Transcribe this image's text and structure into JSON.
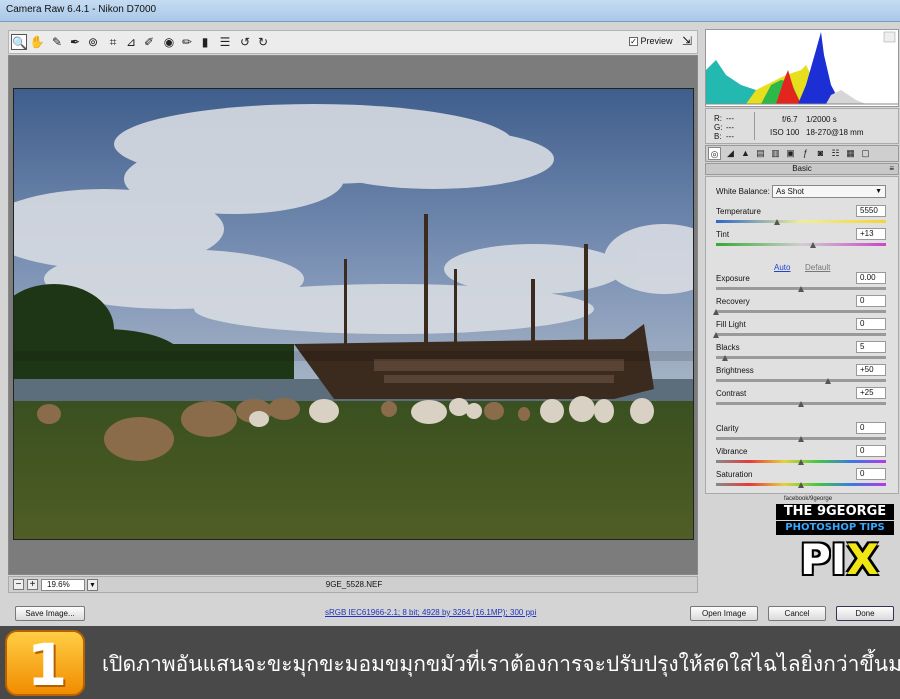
{
  "window": {
    "title": "Camera Raw 6.4.1  -  Nikon D7000"
  },
  "toolbar": {
    "tools": [
      "zoom-tool",
      "hand-tool",
      "white-balance-tool",
      "color-sampler-tool",
      "target-adjustment-tool",
      "crop-tool",
      "straighten-tool",
      "spot-removal-tool",
      "red-eye-tool",
      "adjustment-brush-tool",
      "graduated-filter-tool",
      "preferences",
      "rotate-ccw",
      "rotate-cw"
    ],
    "preview_label": "Preview",
    "preview_checked": true
  },
  "status": {
    "zoom": "19.6%",
    "filename": "9GE_5528.NEF"
  },
  "info": {
    "r_label": "R:",
    "r_val": "---",
    "g_label": "G:",
    "g_val": "---",
    "b_label": "B:",
    "b_val": "---",
    "aperture": "f/6.7",
    "shutter": "1/2000 s",
    "iso": "ISO 100",
    "lens": "18-270@18 mm"
  },
  "panel": {
    "title": "Basic",
    "white_balance_label": "White Balance:",
    "white_balance_value": "As Shot",
    "auto_label": "Auto",
    "default_label": "Default",
    "sliders": {
      "temperature": {
        "label": "Temperature",
        "value": "5550",
        "pos": 0.36
      },
      "tint": {
        "label": "Tint",
        "value": "+13",
        "pos": 0.57
      },
      "exposure": {
        "label": "Exposure",
        "value": "0.00",
        "pos": 0.5
      },
      "recovery": {
        "label": "Recovery",
        "value": "0",
        "pos": 0.0
      },
      "fill_light": {
        "label": "Fill Light",
        "value": "0",
        "pos": 0.0
      },
      "blacks": {
        "label": "Blacks",
        "value": "5",
        "pos": 0.05
      },
      "brightness": {
        "label": "Brightness",
        "value": "+50",
        "pos": 0.66
      },
      "contrast": {
        "label": "Contrast",
        "value": "+25",
        "pos": 0.5
      },
      "clarity": {
        "label": "Clarity",
        "value": "0",
        "pos": 0.5
      },
      "vibrance": {
        "label": "Vibrance",
        "value": "0",
        "pos": 0.5
      },
      "saturation": {
        "label": "Saturation",
        "value": "0",
        "pos": 0.5
      }
    }
  },
  "buttons": {
    "save_image": "Save Image...",
    "open_image": "Open Image",
    "cancel": "Cancel",
    "done": "Done"
  },
  "workflow_link": "sRGB IEC61966-2.1; 8 bit; 4928 by 3264 (16.1MP); 300 ppi",
  "logo": {
    "line1": "THE 9GEORGE",
    "line2": "PHOTOSHOP TIPS",
    "line3a": "PI",
    "line3b": "X",
    "small": "facebook/9george"
  },
  "caption": {
    "step": "1",
    "text": "เปิดภาพอันแสนจะขะมุกขะมอมขมุกขมัวที่เราต้องการจะปรับปรุงให้สดใสไฉไลยิ่งกว่าขึ้นมา"
  },
  "colors": {
    "caption_bg": "#494949",
    "step_badge": "#f7a21b",
    "accent_link": "#2233bb"
  }
}
